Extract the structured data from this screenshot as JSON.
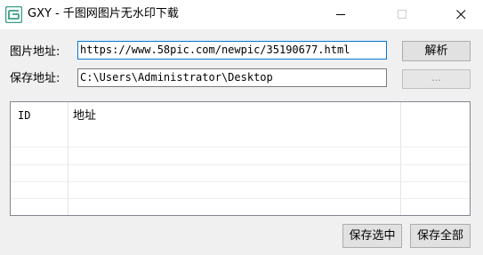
{
  "window": {
    "title": "GXY - 千图网图片无水印下载",
    "icon": "app-logo-icon"
  },
  "form": {
    "url_label": "图片地址:",
    "url_value": "https://www.58pic.com/newpic/35190677.html",
    "save_label": "保存地址:",
    "save_value": "C:\\Users\\Administrator\\Desktop"
  },
  "buttons": {
    "parse": "解析",
    "browse": "...",
    "save_selected": "保存选中",
    "save_all": "保存全部"
  },
  "table": {
    "columns": [
      "ID",
      "地址"
    ],
    "rows": []
  },
  "colors": {
    "focus_border": "#0078d7",
    "icon": "#3a9e86"
  }
}
